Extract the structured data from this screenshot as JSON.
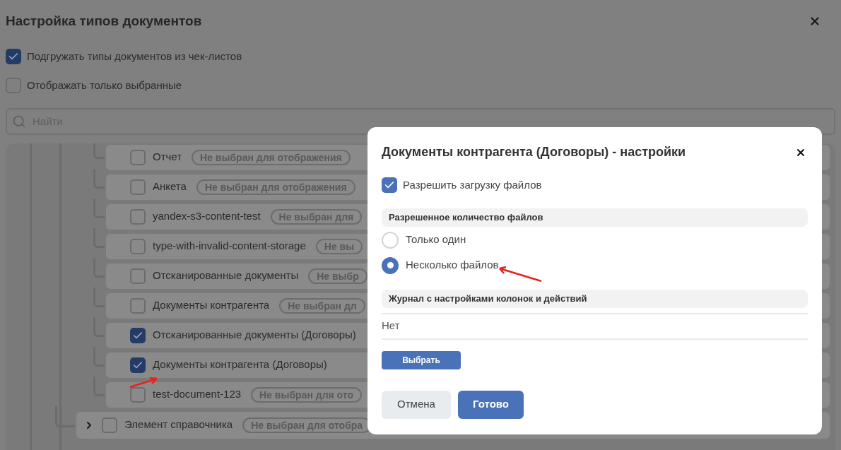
{
  "window": {
    "title": "Настройка типов документов"
  },
  "options": [
    {
      "label": "Подгружать типы документов из чек-листов",
      "checked": true
    },
    {
      "label": "Отображать только выбранные",
      "checked": false
    }
  ],
  "search": {
    "placeholder": "Найти"
  },
  "tree": [
    {
      "children": [
        {
          "label": "Отчет",
          "checked": false,
          "badge": "Не выбран для отображения"
        },
        {
          "label": "Анкета",
          "checked": false,
          "badge": "Не выбран для отображения"
        },
        {
          "label": "yandex-s3-content-test",
          "checked": false,
          "badge": "Не выбран для"
        },
        {
          "label": "type-with-invalid-content-storage",
          "checked": false,
          "badge": "Не вы"
        },
        {
          "label": "Отсканированные документы",
          "checked": false,
          "badge": "Не выбр"
        },
        {
          "label": "Документы контрагента",
          "checked": false,
          "badge": "Не выбран дл"
        },
        {
          "label": "Отсканированные документы (Договоры)",
          "checked": true
        },
        {
          "label": "Документы контрагента (Договоры)",
          "checked": true
        },
        {
          "label": "test-document-123",
          "checked": false,
          "badge": "Не выбран для ото"
        }
      ]
    },
    {
      "label": "Элемент справочника",
      "expanded": false,
      "checked": false,
      "badge": "Не выбран для отобра"
    }
  ],
  "dialog": {
    "title": "Документы контрагента (Договоры) - настройки",
    "allow_upload": {
      "label": "Разрешить загрузку файлов",
      "checked": true
    },
    "file_count": {
      "heading": "Разрешенное количество файлов",
      "options": [
        {
          "label": "Только один",
          "selected": false
        },
        {
          "label": "Несколько файлов",
          "selected": true
        }
      ]
    },
    "journal": {
      "heading": "Журнал с настройками колонок и действий",
      "value": "Нет",
      "button": "Выбрать"
    },
    "buttons": [
      {
        "label": "Отмена",
        "kind": "secondary"
      },
      {
        "label": "Готово",
        "kind": "primary"
      }
    ]
  }
}
